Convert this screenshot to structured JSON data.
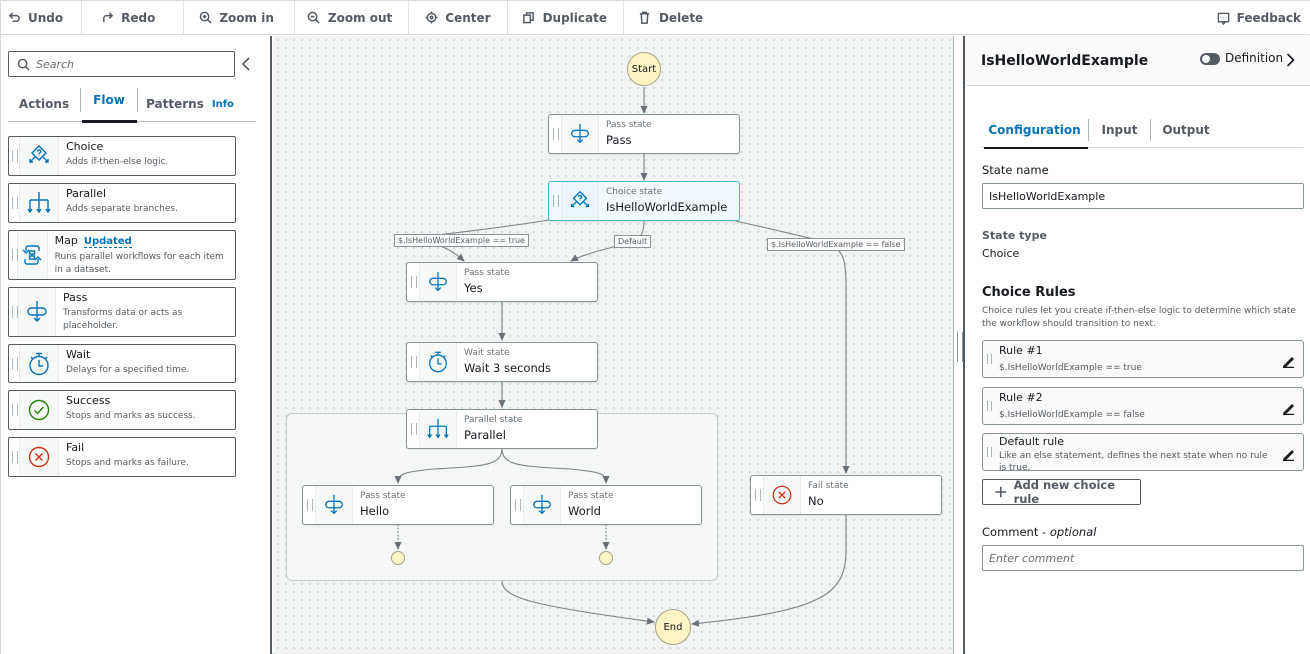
{
  "toolbar": {
    "buttons": [
      {
        "id": "undo",
        "label": "Undo",
        "icon": "undo-icon"
      },
      {
        "id": "redo",
        "label": "Redo",
        "icon": "redo-icon"
      },
      {
        "id": "zoom-in",
        "label": "Zoom in",
        "icon": "zoom-in-icon"
      },
      {
        "id": "zoom-out",
        "label": "Zoom out",
        "icon": "zoom-out-icon"
      },
      {
        "id": "center",
        "label": "Center",
        "icon": "center-icon"
      },
      {
        "id": "duplicate",
        "label": "Duplicate",
        "icon": "duplicate-icon"
      },
      {
        "id": "delete",
        "label": "Delete",
        "icon": "trash-icon"
      }
    ],
    "feedback_label": "Feedback"
  },
  "left_panel": {
    "search_placeholder": "Search",
    "tabs": [
      {
        "label": "Actions",
        "active": false
      },
      {
        "label": "Flow",
        "active": true
      },
      {
        "label": "Patterns",
        "active": false,
        "info": "Info"
      }
    ],
    "items": [
      {
        "title": "Choice",
        "desc": "Adds if-then-else logic.",
        "icon": "choice-icon"
      },
      {
        "title": "Parallel",
        "desc": "Adds separate branches.",
        "icon": "parallel-icon"
      },
      {
        "title": "Map",
        "badge": "Updated",
        "desc": "Runs parallel workflows for each item in a dataset.",
        "icon": "map-icon"
      },
      {
        "title": "Pass",
        "desc": "Transforms data or acts as placeholder.",
        "icon": "pass-icon"
      },
      {
        "title": "Wait",
        "desc": "Delays for a specified time.",
        "icon": "wait-icon"
      },
      {
        "title": "Success",
        "desc": "Stops and marks as success.",
        "icon": "success-icon"
      },
      {
        "title": "Fail",
        "desc": "Stops and marks as failure.",
        "icon": "fail-icon"
      }
    ]
  },
  "canvas": {
    "start_label": "Start",
    "end_label": "End",
    "nodes": {
      "pass": {
        "kind": "Pass state",
        "name": "Pass"
      },
      "choice": {
        "kind": "Choice state",
        "name": "IsHelloWorldExample",
        "selected": true
      },
      "yes": {
        "kind": "Pass state",
        "name": "Yes"
      },
      "wait": {
        "kind": "Wait state",
        "name": "Wait 3 seconds"
      },
      "parallel": {
        "kind": "Parallel state",
        "name": "Parallel"
      },
      "hello": {
        "kind": "Pass state",
        "name": "Hello"
      },
      "world": {
        "kind": "Pass state",
        "name": "World"
      },
      "no": {
        "kind": "Fail state",
        "name": "No"
      }
    },
    "edge_labels": {
      "true_rule": "$.IsHelloWorldExample == true",
      "default": "Default",
      "false_rule": "$.IsHelloWorldExample == false"
    }
  },
  "right_panel": {
    "title": "IsHelloWorldExample",
    "definition_label": "Definition",
    "definition_toggle_on": false,
    "tabs": [
      {
        "label": "Configuration",
        "active": true
      },
      {
        "label": "Input",
        "active": false
      },
      {
        "label": "Output",
        "active": false
      }
    ],
    "state_name_label": "State name",
    "state_name_value": "IsHelloWorldExample",
    "state_type_label": "State type",
    "state_type_value": "Choice",
    "choice_rules_heading": "Choice Rules",
    "choice_rules_desc": "Choice rules let you create if-then-else logic to determine which state the workflow should transition to next.",
    "rules": [
      {
        "title": "Rule #1",
        "sub": "$.IsHelloWorldExample == true"
      },
      {
        "title": "Rule #2",
        "sub": "$.IsHelloWorldExample == false"
      },
      {
        "title": "Default rule",
        "sub": "Like an else statement, defines the next state when no rule is true."
      }
    ],
    "add_rule_label": "Add new choice rule",
    "comment_label": "Comment - ",
    "comment_optional": "optional",
    "comment_placeholder": "Enter comment",
    "comment_value": ""
  },
  "colors": {
    "accent": "#0073bb",
    "icon_blue": "#0073bb",
    "success_green": "#1d8102",
    "fail_red": "#d13212",
    "terminal_fill": "#fdf4c4",
    "selected_border": "#44b9d6"
  }
}
